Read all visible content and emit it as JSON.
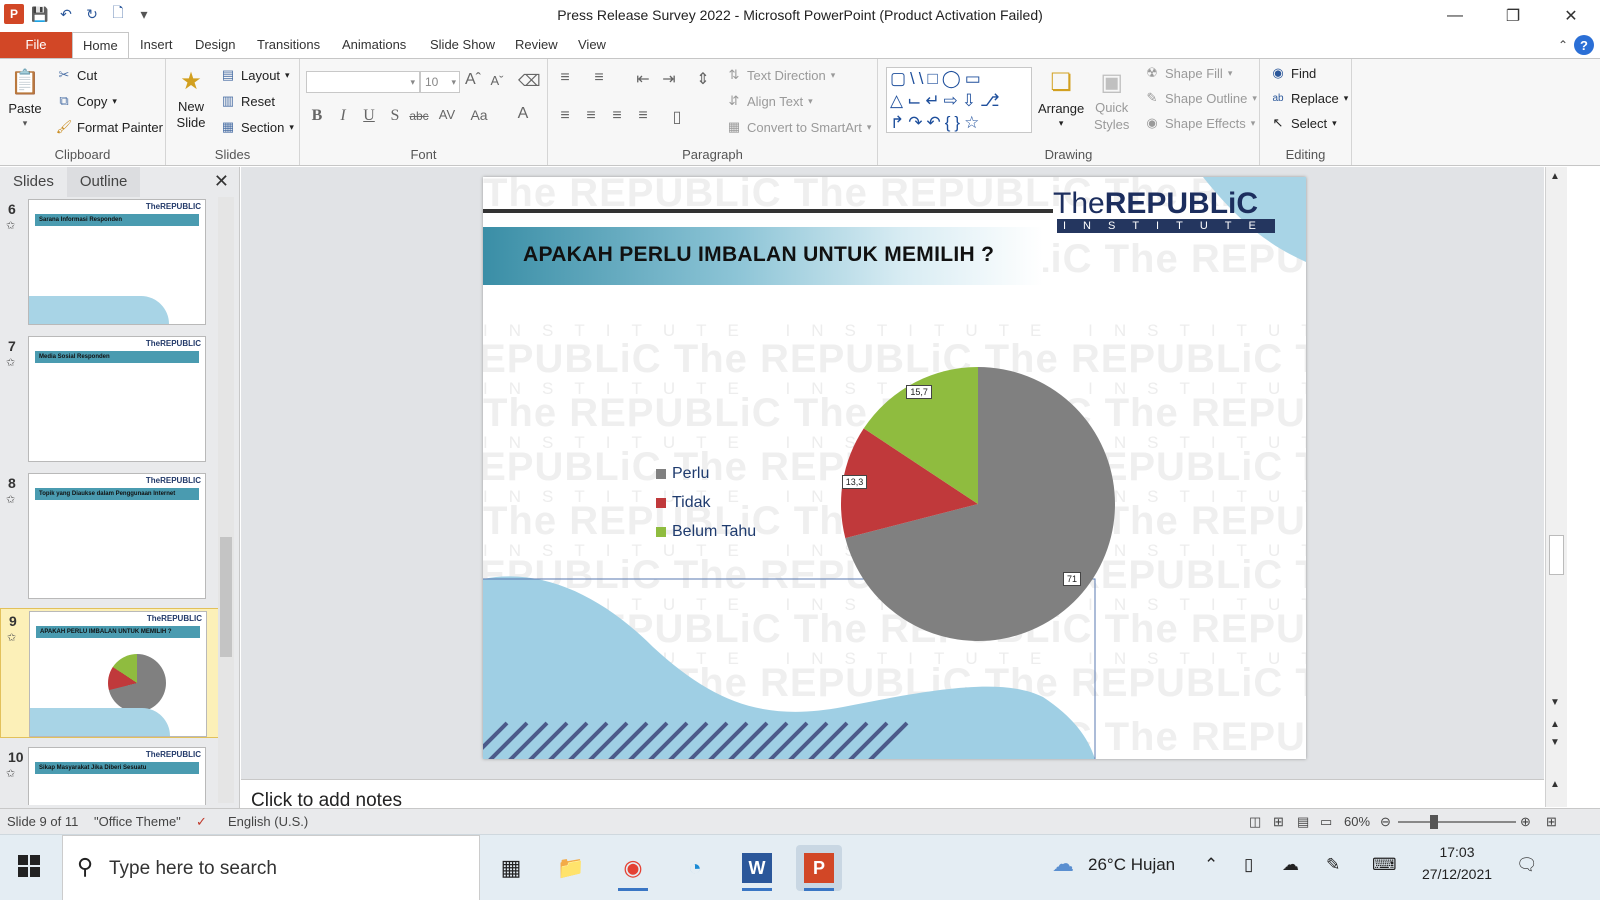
{
  "window": {
    "title": "Press Release Survey 2022  -  Microsoft PowerPoint (Product Activation Failed)",
    "app_icon": "P"
  },
  "tabs": [
    "File",
    "Home",
    "Insert",
    "Design",
    "Transitions",
    "Animations",
    "Slide Show",
    "Review",
    "View"
  ],
  "ribbon": {
    "clipboard": {
      "label": "Clipboard",
      "paste": "Paste",
      "cut": "Cut",
      "copy": "Copy",
      "format_painter": "Format Painter"
    },
    "slides": {
      "label": "Slides",
      "new_slide_1": "New",
      "new_slide_2": "Slide",
      "layout": "Layout",
      "reset": "Reset",
      "section": "Section"
    },
    "font": {
      "label": "Font",
      "size": "10"
    },
    "paragraph": {
      "label": "Paragraph",
      "text_direction": "Text Direction",
      "align_text": "Align Text",
      "convert_smartart": "Convert to SmartArt"
    },
    "drawing": {
      "label": "Drawing",
      "arrange": "Arrange",
      "quick_1": "Quick",
      "quick_2": "Styles",
      "shape_fill": "Shape Fill",
      "shape_outline": "Shape Outline",
      "shape_effects": "Shape Effects"
    },
    "editing": {
      "label": "Editing",
      "find": "Find",
      "replace": "Replace",
      "select": "Select"
    }
  },
  "panel": {
    "tab_slides": "Slides",
    "tab_outline": "Outline",
    "thumbs": [
      {
        "num": "6",
        "title": "Sarana Informasi Responden"
      },
      {
        "num": "7",
        "title": "Media Sosial Responden"
      },
      {
        "num": "8",
        "title": "Topik yang Diaukse dalam Penggunaan Internet"
      },
      {
        "num": "9",
        "title": "APAKAH PERLU IMBALAN UNTUK MEMILIH ?"
      },
      {
        "num": "10",
        "title": "Sikap Masyarakat Jika Diberi Sesuatu"
      }
    ]
  },
  "slide": {
    "logo_the": "The",
    "logo_republic": "REPUBLiC",
    "logo_institute": "INSTITUTE",
    "title": "APAKAH  PERLU IMBALAN  UNTUK MEMILIH ?",
    "watermark": "The REPUBLiC The REPUBLiC The REPUBLiC The REPUBLiC",
    "watermark_sub": "INSTITUTE INSTITUTE INSTITUTE INSTITUTE"
  },
  "chart_data": {
    "type": "pie",
    "categories": [
      "Perlu",
      "Tidak",
      "Belum Tahu"
    ],
    "values": [
      71,
      13.3,
      15.7
    ],
    "labels": [
      "71",
      "13,3",
      "15,7"
    ],
    "colors": [
      "#808080",
      "#c0393b",
      "#8fbc3f"
    ],
    "legend_position": "left"
  },
  "notes": {
    "placeholder": "Click to add notes"
  },
  "status": {
    "slide_info": "Slide 9 of 11",
    "theme": "\"Office Theme\"",
    "language": "English (U.S.)",
    "zoom": "60%"
  },
  "taskbar": {
    "search_placeholder": "Type here to search",
    "weather": "26°C  Hujan",
    "time": "17:03",
    "date": "27/12/2021"
  }
}
